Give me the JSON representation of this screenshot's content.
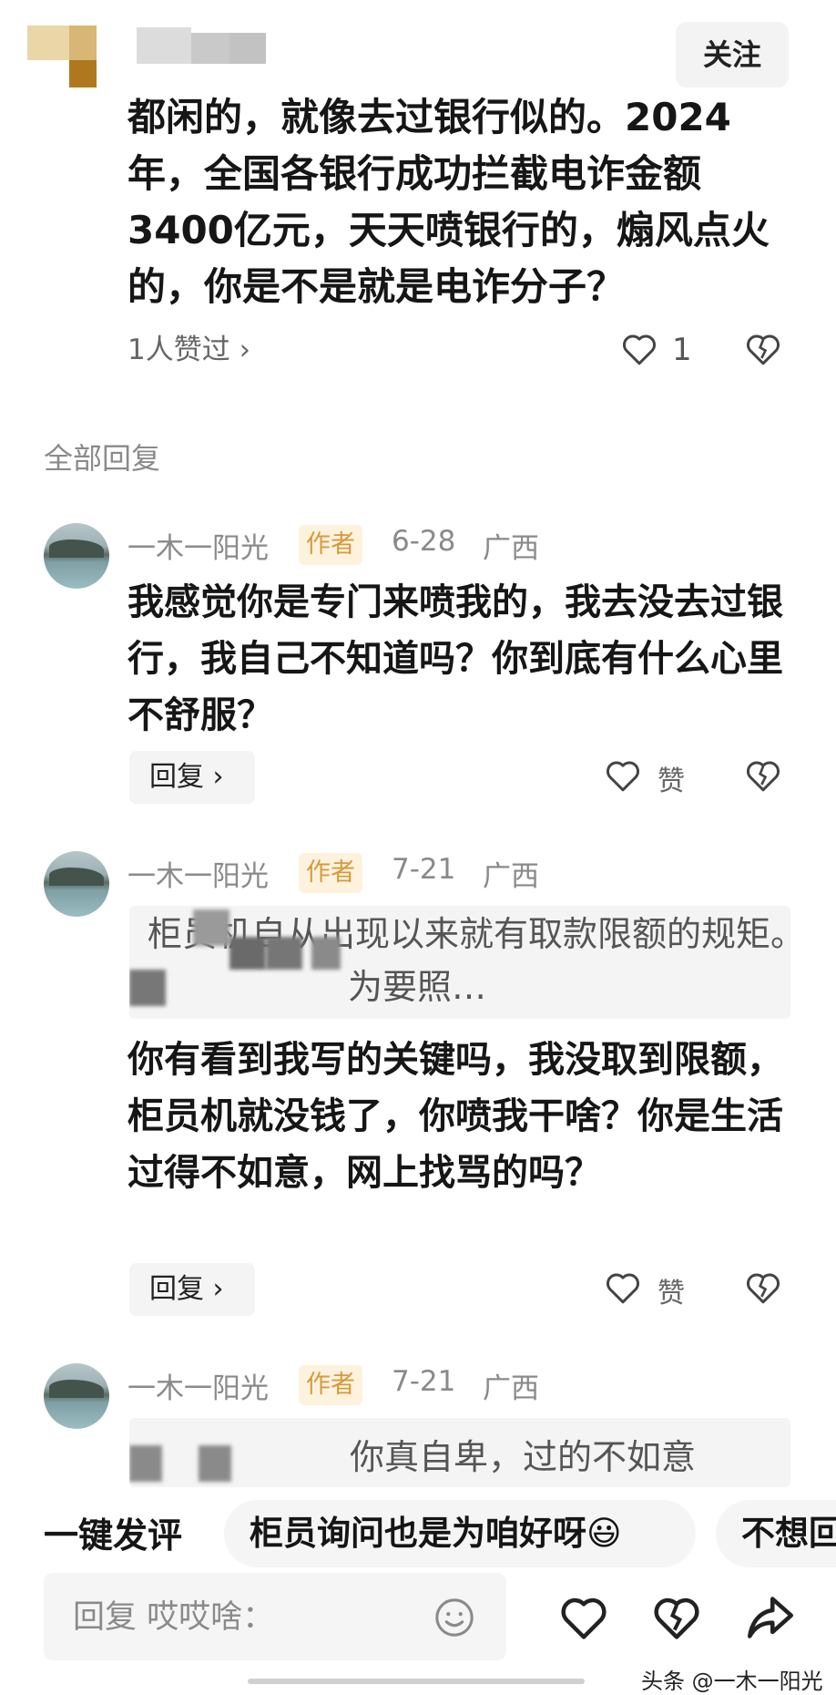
{
  "header": {
    "follow_label": "关注"
  },
  "post": {
    "text": "都闲的，就像去过银行似的。2024年，全国各银行成功拦截电诈金额3400亿元，天天喷银行的，煽风点火的，你是不是就是电诈分子？",
    "likers": "1人赞过 ›",
    "like_count": "1"
  },
  "section_title": "全部回复",
  "replies": [
    {
      "name": "一木一阳光",
      "badge": "作者",
      "date": "6-28",
      "region": "广西",
      "text": "我感觉你是专门来喷我的，我去没去过银行，我自己不知道吗？你到底有什么心里不舒服？",
      "reply_label": "回复 ›",
      "like_label": "赞"
    },
    {
      "name": "一木一阳光",
      "badge": "作者",
      "date": "7-21",
      "region": "广西",
      "quote": "柜员机自从出现以来就有取款限额的规矩。因为要照…",
      "text": "你有看到我写的关键吗，我没取到限额，柜员机就没钱了，你喷我干啥？你是生活过得不如意，网上找骂的吗？",
      "reply_label": "回复 ›",
      "like_label": "赞"
    },
    {
      "name": "一木一阳光",
      "badge": "作者",
      "date": "7-21",
      "region": "广西",
      "quote": "你真自卑，过的不如意"
    }
  ],
  "suggest": {
    "label": "一键发评",
    "chips": [
      "柜员询问也是为咱好呀😃",
      "不想回"
    ]
  },
  "input": {
    "placeholder": "回复 哎哎啥："
  },
  "watermark": "头条 @一木一阳光",
  "icons": {
    "heart": "heart-icon",
    "broken_heart": "broken-heart-icon",
    "emoji": "emoji-icon",
    "share": "share-icon"
  }
}
